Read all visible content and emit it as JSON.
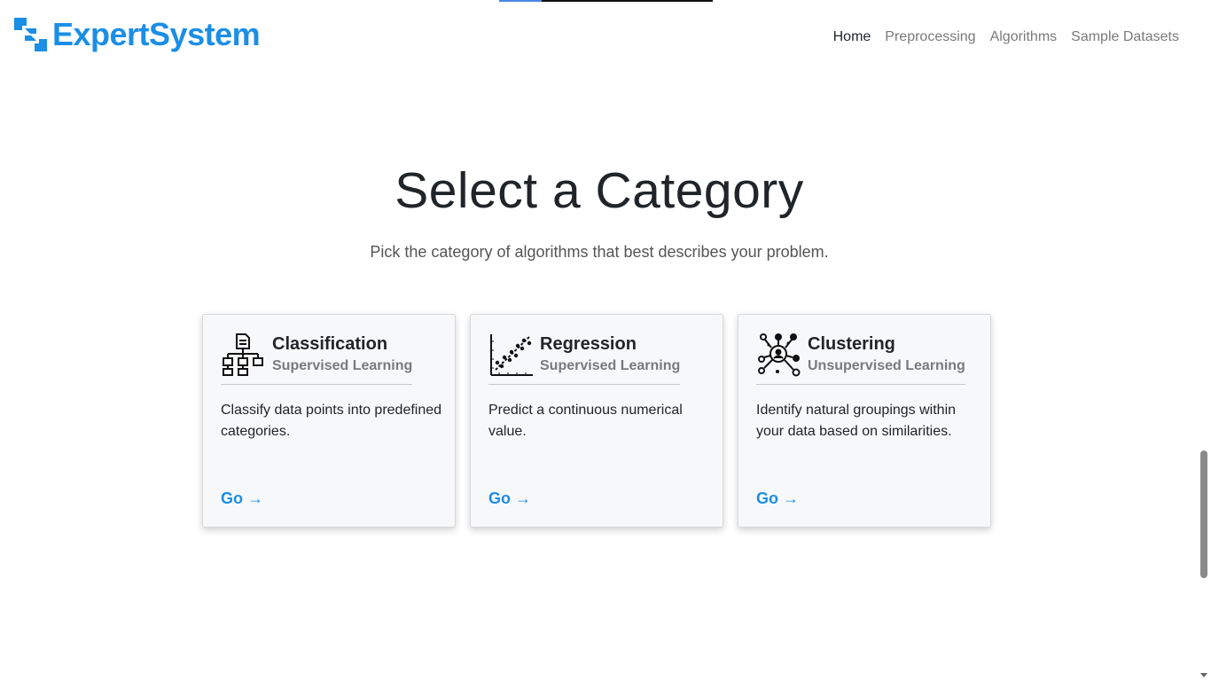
{
  "app": {
    "brand": "ExpertSystem",
    "brand_color": "#1b8ee6"
  },
  "nav": {
    "items": [
      {
        "label": "Home",
        "active": true
      },
      {
        "label": "Preprocessing",
        "active": false
      },
      {
        "label": "Algorithms",
        "active": false
      },
      {
        "label": "Sample Datasets",
        "active": false
      }
    ]
  },
  "hero": {
    "title": "Select a Category",
    "subtitle": "Pick the category of algorithms that best describes your problem."
  },
  "cards": [
    {
      "title": "Classification",
      "subtitle": "Supervised Learning",
      "description": "Classify data points into predefined categories.",
      "link": "Go →",
      "icon": "hierarchy-tree-icon"
    },
    {
      "title": "Regression",
      "subtitle": "Supervised Learning",
      "description": "Predict a continuous numerical value.",
      "link": "Go →",
      "icon": "scatter-trend-icon"
    },
    {
      "title": "Clustering",
      "subtitle": "Unsupervised Learning",
      "description": "Identify natural groupings within your data based on similarities.",
      "link": "Go →",
      "icon": "network-cluster-icon"
    }
  ],
  "progress": {
    "fraction": 0.2
  },
  "colors": {
    "accent": "#1b8ee6",
    "card_bg": "#f7f8fa",
    "muted_text": "#7a7a7a"
  }
}
